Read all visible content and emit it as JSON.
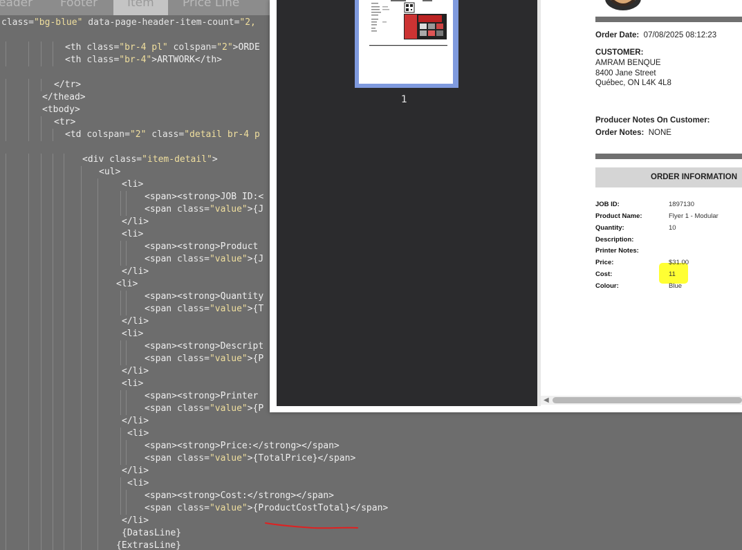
{
  "editor": {
    "tabs": [
      "eader",
      "Footer",
      "Item",
      "Price Line"
    ],
    "active_tab_index": 2,
    "lines": [
      {
        "indent": 0,
        "parts": [
          [
            "attr",
            "class="
          ],
          [
            "str",
            "\"bg-blue\""
          ],
          [
            "attr",
            " data-page-header-item-count="
          ],
          [
            "str",
            "\"2,"
          ]
        ]
      },
      {
        "indent": 0,
        "parts": [
          [
            "tag",
            ""
          ]
        ]
      },
      {
        "indent": 92,
        "parts": [
          [
            "tag",
            "<th "
          ],
          [
            "attr",
            "class="
          ],
          [
            "str",
            "\"br-4 pl\""
          ],
          [
            "attr",
            " colspan="
          ],
          [
            "str",
            "\"2\""
          ],
          [
            "tag",
            ">ORDE"
          ]
        ]
      },
      {
        "indent": 92,
        "parts": [
          [
            "tag",
            "<th "
          ],
          [
            "attr",
            "class="
          ],
          [
            "str",
            "\"br-4\""
          ],
          [
            "tag",
            ">ARTWORK</th>"
          ]
        ]
      },
      {
        "indent": 0,
        "parts": [
          [
            "tag",
            ""
          ]
        ]
      },
      {
        "indent": 76,
        "parts": [
          [
            "tag",
            "</tr>"
          ]
        ]
      },
      {
        "indent": 59,
        "parts": [
          [
            "tag",
            "</thead>"
          ]
        ]
      },
      {
        "indent": 59,
        "parts": [
          [
            "tag",
            "<tbody>"
          ]
        ]
      },
      {
        "indent": 76,
        "parts": [
          [
            "tag",
            "<tr>"
          ]
        ]
      },
      {
        "indent": 92,
        "parts": [
          [
            "tag",
            "<td "
          ],
          [
            "attr",
            "colspan="
          ],
          [
            "str",
            "\"2\""
          ],
          [
            "attr",
            " class="
          ],
          [
            "str",
            "\"detail br-4 p"
          ]
        ]
      },
      {
        "indent": 0,
        "parts": [
          [
            "tag",
            ""
          ]
        ]
      },
      {
        "indent": 117,
        "parts": [
          [
            "tag",
            "<div "
          ],
          [
            "attr",
            "class="
          ],
          [
            "str",
            "\"item-detail\""
          ],
          [
            "tag",
            ">"
          ]
        ]
      },
      {
        "indent": 141,
        "parts": [
          [
            "tag",
            "<ul>"
          ]
        ]
      },
      {
        "indent": 174,
        "parts": [
          [
            "tag",
            "<li>"
          ]
        ]
      },
      {
        "indent": 207,
        "parts": [
          [
            "tag",
            "<span><strong>JOB ID:<"
          ]
        ]
      },
      {
        "indent": 207,
        "parts": [
          [
            "tag",
            "<span "
          ],
          [
            "attr",
            "class="
          ],
          [
            "str",
            "\"value\""
          ],
          [
            "tag",
            ">{J"
          ]
        ]
      },
      {
        "indent": 174,
        "parts": [
          [
            "tag",
            "</li>"
          ]
        ]
      },
      {
        "indent": 174,
        "parts": [
          [
            "tag",
            "<li>"
          ]
        ]
      },
      {
        "indent": 207,
        "parts": [
          [
            "tag",
            "<span><strong>Product "
          ]
        ]
      },
      {
        "indent": 207,
        "parts": [
          [
            "tag",
            "<span "
          ],
          [
            "attr",
            "class="
          ],
          [
            "str",
            "\"value\""
          ],
          [
            "tag",
            ">{J"
          ]
        ]
      },
      {
        "indent": 174,
        "parts": [
          [
            "tag",
            "</li>"
          ]
        ]
      },
      {
        "indent": 166,
        "parts": [
          [
            "tag",
            "<li>"
          ]
        ]
      },
      {
        "indent": 207,
        "parts": [
          [
            "tag",
            "<span><strong>Quantity"
          ]
        ]
      },
      {
        "indent": 207,
        "parts": [
          [
            "tag",
            "<span "
          ],
          [
            "attr",
            "class="
          ],
          [
            "str",
            "\"value\""
          ],
          [
            "tag",
            ">{T"
          ]
        ]
      },
      {
        "indent": 174,
        "parts": [
          [
            "tag",
            "</li>"
          ]
        ]
      },
      {
        "indent": 174,
        "parts": [
          [
            "tag",
            "<li>"
          ]
        ]
      },
      {
        "indent": 207,
        "parts": [
          [
            "tag",
            "<span><strong>Descript"
          ]
        ]
      },
      {
        "indent": 207,
        "parts": [
          [
            "tag",
            "<span "
          ],
          [
            "attr",
            "class="
          ],
          [
            "str",
            "\"value\""
          ],
          [
            "tag",
            ">{P"
          ]
        ]
      },
      {
        "indent": 174,
        "parts": [
          [
            "tag",
            "</li>"
          ]
        ]
      },
      {
        "indent": 174,
        "parts": [
          [
            "tag",
            "<li>"
          ]
        ]
      },
      {
        "indent": 207,
        "parts": [
          [
            "tag",
            "<span><strong>Printer "
          ]
        ]
      },
      {
        "indent": 207,
        "parts": [
          [
            "tag",
            "<span "
          ],
          [
            "attr",
            "class="
          ],
          [
            "str",
            "\"value\""
          ],
          [
            "tag",
            ">{P"
          ]
        ]
      },
      {
        "indent": 174,
        "parts": [
          [
            "tag",
            "</li>"
          ]
        ]
      },
      {
        "indent": 182,
        "parts": [
          [
            "tag",
            "<li>"
          ]
        ]
      },
      {
        "indent": 207,
        "parts": [
          [
            "tag",
            "<span><strong>Price:</strong></span>"
          ]
        ]
      },
      {
        "indent": 207,
        "parts": [
          [
            "tag",
            "<span "
          ],
          [
            "attr",
            "class="
          ],
          [
            "str",
            "\"value\""
          ],
          [
            "tag",
            ">{TotalPrice}</span>"
          ]
        ]
      },
      {
        "indent": 174,
        "parts": [
          [
            "tag",
            "</li>"
          ]
        ]
      },
      {
        "indent": 182,
        "parts": [
          [
            "tag",
            "<li>"
          ]
        ]
      },
      {
        "indent": 207,
        "parts": [
          [
            "tag",
            "<span><strong>Cost:</strong></span>"
          ]
        ]
      },
      {
        "indent": 207,
        "parts": [
          [
            "tag",
            "<span "
          ],
          [
            "attr",
            "class="
          ],
          [
            "str",
            "\"value\""
          ],
          [
            "tag",
            ">{ProductCostTotal}</span>"
          ]
        ]
      },
      {
        "indent": 174,
        "parts": [
          [
            "tag",
            "</li>"
          ]
        ]
      },
      {
        "indent": 174,
        "parts": [
          [
            "tag",
            "{DatasLine}"
          ]
        ]
      },
      {
        "indent": 166,
        "parts": [
          [
            "tag",
            "{ExtrasLine}"
          ]
        ]
      }
    ]
  },
  "viewer": {
    "page_number": "1",
    "order_date_label": "Order Date:",
    "order_date_value": "07/08/2025 08:12:23",
    "customer_label": "CUSTOMER:",
    "customer_lines": [
      "AMRAM BENQUE",
      "8400 Jane Street",
      "Québec, ON  L4K 4L8"
    ],
    "producer_notes_label": "Producer Notes On Customer:",
    "order_notes_label": "Order Notes:",
    "order_notes_value": "NONE",
    "order_info_title": "ORDER INFORMATION",
    "items": [
      {
        "label": "JOB ID:",
        "value": "1897130"
      },
      {
        "label": "Product Name:",
        "value": "Flyer 1 - Modular"
      },
      {
        "label": "Quantity:",
        "value": "10"
      },
      {
        "label": "Description:",
        "value": ""
      },
      {
        "label": "Printer Notes:",
        "value": ""
      },
      {
        "label": "Price:",
        "value": "$31.00"
      },
      {
        "label": "Cost:",
        "value": "11"
      },
      {
        "label": "Colour:",
        "value": "Blue"
      }
    ],
    "highlight_color": "#ffff33",
    "annotation_color": "#e02020"
  }
}
